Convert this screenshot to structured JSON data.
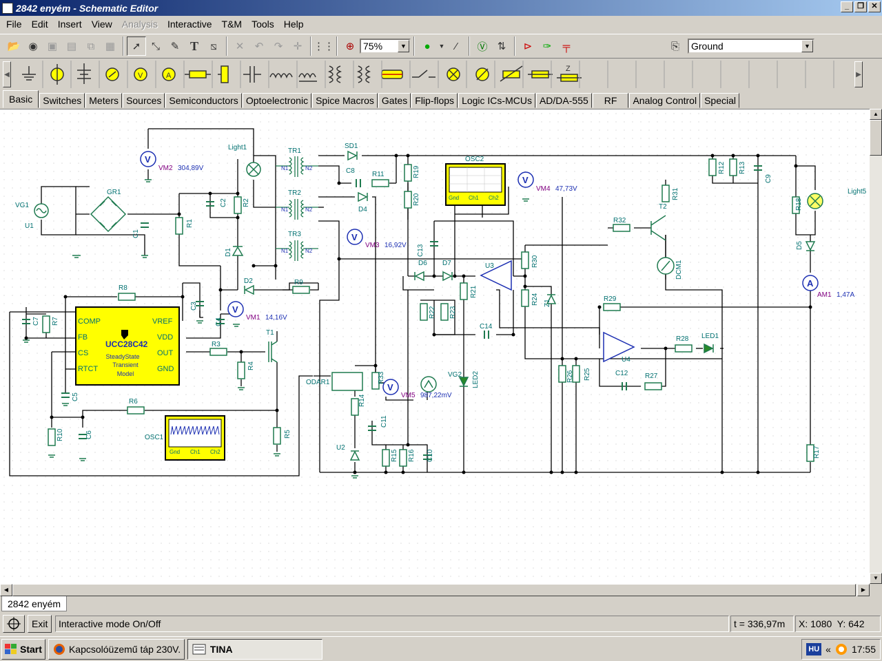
{
  "window": {
    "title": "2842 enyém - Schematic Editor",
    "controls": [
      "_",
      "❐",
      "✕"
    ]
  },
  "menu": [
    {
      "label": "File",
      "enabled": true
    },
    {
      "label": "Edit",
      "enabled": true
    },
    {
      "label": "Insert",
      "enabled": true
    },
    {
      "label": "View",
      "enabled": true
    },
    {
      "label": "Analysis",
      "enabled": false
    },
    {
      "label": "Interactive",
      "enabled": true
    },
    {
      "label": "T&M",
      "enabled": true
    },
    {
      "label": "Tools",
      "enabled": true
    },
    {
      "label": "Help",
      "enabled": true
    }
  ],
  "toolbar": {
    "zoom_value": "75%",
    "ground_value": "Ground",
    "icons": [
      "open-icon",
      "web-icon",
      "save-icon",
      "open-folder-icon",
      "copy-icon",
      "paste-icon",
      "pointer-icon",
      "wire-icon",
      "pen-icon",
      "text-icon",
      "tag-icon",
      "delete-icon",
      "undo-icon",
      "redo-icon",
      "junction-icon",
      "grid-icon",
      "zoom-icon"
    ]
  },
  "components_toolbar": {
    "icons": [
      "ground-icon",
      "battery-icon",
      "dc-voltage-icon",
      "current-source-icon",
      "voltmeter-icon",
      "ammeter-icon",
      "resistor-icon",
      "resistor-vertical-icon",
      "capacitor-icon",
      "inductor-icon",
      "transformer-icon",
      "transformer2-icon",
      "transformer3-icon",
      "fuse-icon",
      "switch-icon",
      "lamp-icon",
      "motor-icon",
      "potentiometer-icon",
      "resistor-h-icon",
      "impedance-icon"
    ],
    "impedance_label": "Z"
  },
  "tabs": [
    "Basic",
    "Switches",
    "Meters",
    "Sources",
    "Semiconductors",
    "Optoelectronic",
    "Spice Macros",
    "Gates",
    "Flip-flops",
    "Logic ICs-MCUs",
    "AD/DA-555",
    "RF",
    "Analog Control",
    "Special"
  ],
  "active_tab": "Basic",
  "schematic": {
    "meters": {
      "vm2": {
        "name": "VM2",
        "value": "304,89V"
      },
      "vm4": {
        "name": "VM4",
        "value": "47,73V"
      },
      "vm3": {
        "name": "VM3",
        "value": "16,92V"
      },
      "vm1": {
        "name": "VM1",
        "value": "14,16V"
      },
      "vm5": {
        "name": "VM5",
        "value": "987,22mV"
      },
      "am1": {
        "name": "AM1",
        "value": "1,47A"
      }
    },
    "ic": {
      "name": "UCC28C42",
      "pins_left": [
        "COMP",
        "FB",
        "CS",
        "RTCT"
      ],
      "pins_right": [
        "VREF",
        "VDD",
        "OUT",
        "GND"
      ],
      "subtitle": [
        "SteadyState",
        "Transient",
        "Model"
      ]
    },
    "scope_labels": [
      "Gnd",
      "Ch1",
      "Ch2"
    ],
    "labels": {
      "osc1": "OSC1",
      "osc2": "OSC2",
      "vg1": "VG1",
      "u1": "U1",
      "gr1": "GR1",
      "c1": "C1",
      "r1": "R1",
      "c2": "C2",
      "r2": "R2",
      "d1": "D1",
      "tr1": "TR1",
      "tr2": "TR2",
      "tr3": "TR3",
      "light1": "Light1",
      "light5": "Light5",
      "sd1": "SD1",
      "c8": "C8",
      "r11": "R11",
      "r19": "R19",
      "r20": "R20",
      "d4": "D4",
      "c13": "C13",
      "d6": "D6",
      "d7": "D7",
      "u3": "U3",
      "r30": "R30",
      "r24": "R24",
      "z1": "Z1",
      "r21": "R21",
      "r22": "R22",
      "r23": "R23",
      "c14": "C14",
      "r31": "R31",
      "t2": "T2",
      "r32": "R32",
      "dcm1": "DCM1",
      "r12": "R12",
      "r13": "R13",
      "c9": "C9",
      "r18": "R18",
      "d5": "D5",
      "r29": "R29",
      "u4": "U4",
      "r28": "R28",
      "led1": "LED1",
      "c12": "C12",
      "r27": "R27",
      "r26": "R26",
      "r25": "R25",
      "r17": "R17",
      "r8": "R8",
      "c7": "C7",
      "r7": "R7",
      "c5": "C5",
      "r3": "R3",
      "r4": "R4",
      "t1": "T1",
      "r5": "R5",
      "r6": "R6",
      "r10": "R10",
      "c6": "C6",
      "c3": "C3",
      "c4": "C4",
      "d2": "D2",
      "r9": "R9",
      "odar1": "ODAR1",
      "r33": "R33",
      "r14": "R14",
      "c11": "C11",
      "u2": "U2",
      "r15": "R15",
      "r16": "R16",
      "c10": "C10",
      "vg2": "VG2",
      "led2": "LED2",
      "n1": "N1",
      "n2": "N2"
    }
  },
  "document_tab": "2842 enyém",
  "status": {
    "exit_label": "Exit",
    "message": "Interactive mode On/Off",
    "time": "t = 336,97m",
    "coords": "X: 1080  Y: 642"
  },
  "taskbar": {
    "start_label": "Start",
    "tasks": [
      {
        "label": "Kapcsolóüzemű táp 230V...",
        "active": false
      },
      {
        "label": "TINA",
        "active": true
      }
    ],
    "language": "HU",
    "chevron": "«",
    "clock": "17:55"
  },
  "colors": {
    "titlebar_start": "#0a246a",
    "wire": "#000000",
    "component": "#1e7a4f",
    "meter": "#1c2fb2",
    "ic_fill": "#ffff00",
    "label": "#007070"
  }
}
